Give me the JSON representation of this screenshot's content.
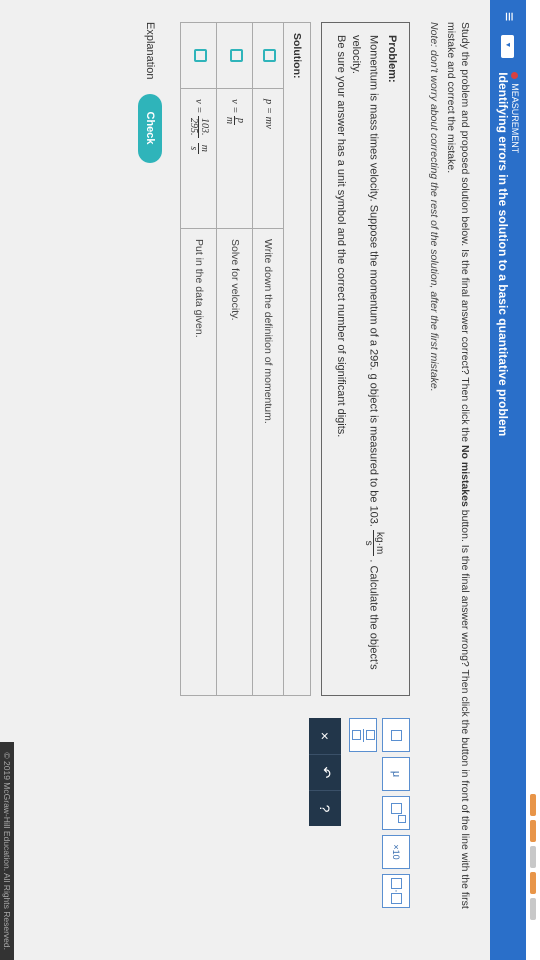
{
  "header": {
    "category": "MEASUREMENT",
    "title": "Identifying errors in the solution to a basic quantitative problem"
  },
  "instructions": {
    "line1_a": "Study the problem and proposed solution below. Is the final answer correct? Then click the ",
    "line1_b": "No mistakes",
    "line1_c": " button. Is the final answer wrong? Then click the button in front of the line with the first mistake and correct the mistake.",
    "note_label": "Note:",
    "note_text": " don't worry about correcting the rest of the solution, after the first mistake."
  },
  "problem": {
    "heading": "Problem:",
    "text_a": "Momentum is mass times velocity. Suppose the momentum of a 295. g object is measured to be 103. ",
    "unit_num": "kg·m",
    "unit_den": "s",
    "text_b": ". Calculate the object's velocity.",
    "text_c": "Be sure your answer has a unit symbol and the correct number of significant digits."
  },
  "solution": {
    "heading": "Solution:",
    "rows": [
      {
        "eq": "p = mv",
        "desc": "Write down the definition of momentum."
      },
      {
        "eq_html": "v = p / m",
        "desc": "Solve for velocity."
      },
      {
        "eq_html": "v = 103./295. m/s",
        "desc": "Put in the data given."
      }
    ]
  },
  "tools": {
    "symbols": {
      "mu": "μ",
      "times10": "×10"
    },
    "clear": "×",
    "undo": "↶",
    "help": "?"
  },
  "footer": {
    "explanation": "Explanation",
    "check": "Check",
    "copyright": "© 2019 McGraw-Hill Education. All Rights Reserved."
  }
}
